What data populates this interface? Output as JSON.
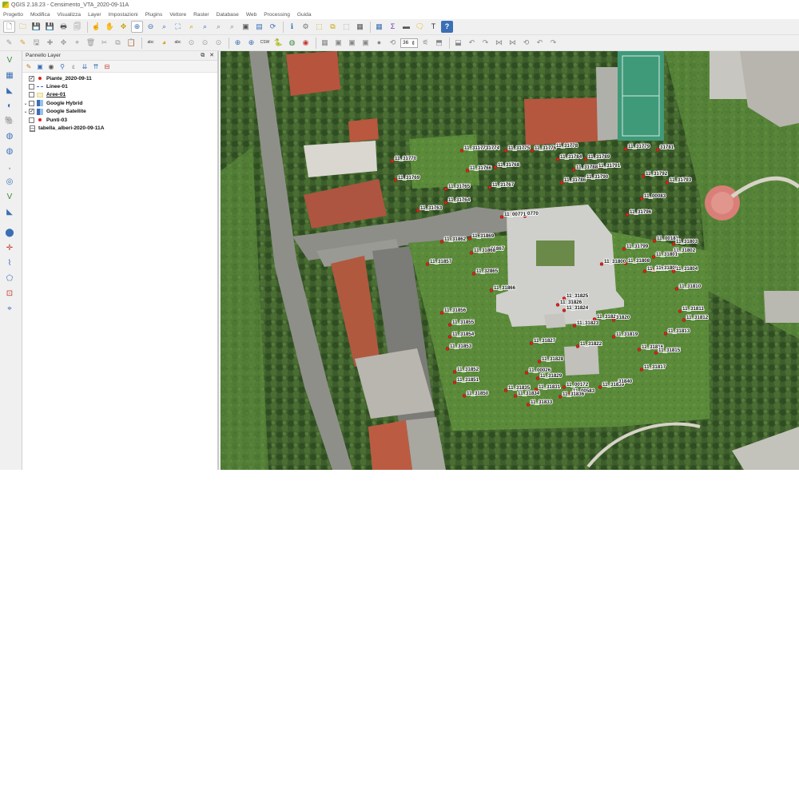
{
  "window": {
    "title": "QGIS 2.18.23 - Censimento_VTA_2020-09-11A"
  },
  "menubar": [
    "Progetto",
    "Modifica",
    "Visualizza",
    "Layer",
    "Impostazioni",
    "Plugins",
    "Vettore",
    "Raster",
    "Database",
    "Web",
    "Processing",
    "Guida"
  ],
  "toolbar1": {
    "icons": [
      "new-project-icon",
      "open-project-icon",
      "save-project-icon",
      "save-as-icon",
      "print-composer-icon",
      "composer-manager-icon",
      "touch-icon",
      "pan-icon",
      "pan-to-selection-icon",
      "zoom-in-icon",
      "zoom-out-icon",
      "zoom-native-icon",
      "zoom-full-icon",
      "zoom-selection-icon",
      "zoom-layer-icon",
      "zoom-last-icon",
      "zoom-next-icon",
      "new-map-view-icon",
      "bookmark-icon",
      "refresh-icon",
      "identify-icon",
      "run-action-icon",
      "select-feature-icon",
      "select-by-value-icon",
      "deselect-icon",
      "attribute-table-icon",
      "field-calculator-icon",
      "statistics-icon",
      "measure-icon",
      "annotation-icon",
      "text-annotation-icon",
      "help-icon"
    ]
  },
  "toolbar2": {
    "icons": [
      "current-edits-icon",
      "toggle-editing-icon",
      "save-edits-icon",
      "add-feature-icon",
      "move-feature-icon",
      "node-tool-icon",
      "delete-selected-icon",
      "cut-features-icon",
      "copy-features-icon",
      "paste-features-icon",
      "label-icon",
      "pin-labels-icon",
      "highlight-labels-icon",
      "move-label-icon",
      "rotate-label-icon",
      "change-label-icon",
      "search-location-icon",
      "geocode-icon",
      "csw-icon",
      "python-icon",
      "openlayers-icon",
      "plugin-icon",
      "digitize-add-ring-icon",
      "digitize-fill-ring-icon",
      "digitize-split-icon",
      "digitize-merge-icon",
      "digitize-circle-icon",
      "rotate-feature-icon",
      "simplify-icon",
      "add-part-icon",
      "delete-ring-icon",
      "offset-curve-icon",
      "reshape-icon",
      "split-parts-icon",
      "merge-attributes-icon",
      "rotate-point-icon",
      "undo-icon",
      "redo-icon"
    ],
    "zoom_value": "36"
  },
  "left_toolbar": {
    "icons": [
      "add-vector-icon",
      "add-raster-icon",
      "add-spatialite-icon",
      "add-wms-icon",
      "add-postgis-icon",
      "add-wcs-icon",
      "add-wfs-icon",
      "add-delimited-text-icon",
      "add-virtual-layer-icon",
      "new-shapefile-icon",
      "new-spatialite-icon",
      "new-gpx-icon",
      "add-point-icon",
      "capture-line-icon",
      "capture-polygon-icon",
      "vertex-icon",
      "georeference-icon"
    ]
  },
  "layer_panel": {
    "title": "Pannello Layer",
    "layers": [
      {
        "name": "Piante_2020-09-11",
        "checked": true,
        "expander": "",
        "symbol": "point-red",
        "style": "bold"
      },
      {
        "name": "Linee-01",
        "checked": false,
        "expander": "",
        "symbol": "line-dash",
        "style": "bold"
      },
      {
        "name": "Aree-01",
        "checked": false,
        "expander": "",
        "symbol": "poly-yellow",
        "style": "under"
      },
      {
        "name": "Google Hybrid",
        "checked": false,
        "expander": "⌄",
        "symbol": "raster",
        "style": "bold"
      },
      {
        "name": "Google Satellite",
        "checked": true,
        "expander": "⌄",
        "symbol": "raster",
        "style": "bold"
      },
      {
        "name": "Punti-03",
        "checked": false,
        "expander": "",
        "symbol": "point-red",
        "style": "bold"
      },
      {
        "name": "tabella_alberi-2020-09-11A",
        "checked": null,
        "expander": "",
        "symbol": "table",
        "style": "bold"
      }
    ]
  },
  "map": {
    "labels": [
      {
        "text": "11_31770",
        "x": 1,
        "y": 1
      },
      {
        "text": "11_31769",
        "x": 1,
        "y": 1
      },
      {
        "text": "11_31765",
        "x": 1,
        "y": 1
      },
      {
        "text": "11_31764",
        "x": 1,
        "y": 1
      },
      {
        "text": "11_31763",
        "x": 1,
        "y": 1
      },
      {
        "text": "11_3117731774",
        "x": 1,
        "y": 1
      },
      {
        "text": "11_31775",
        "x": 1,
        "y": 1
      },
      {
        "text": "11_31776",
        "x": 1,
        "y": 1
      },
      {
        "text": "11_31766",
        "x": 1,
        "y": 1
      },
      {
        "text": "11_31768",
        "x": 1,
        "y": 1
      },
      {
        "text": "11_31767",
        "x": 1,
        "y": 1
      },
      {
        "text": "11_31778",
        "x": 1,
        "y": 1
      },
      {
        "text": "11_31784",
        "x": 1,
        "y": 1
      },
      {
        "text": "11_31789",
        "x": 1,
        "y": 1
      },
      {
        "text": "11_31788",
        "x": 1,
        "y": 1
      },
      {
        "text": "11_31791",
        "x": 1,
        "y": 1
      },
      {
        "text": "11_31790",
        "x": 1,
        "y": 1
      },
      {
        "text": "11_31786",
        "x": 1,
        "y": 1
      },
      {
        "text": "11_00771",
        "x": 1,
        "y": 1
      },
      {
        "text": "0770",
        "x": 1,
        "y": 1
      },
      {
        "text": "11_31779",
        "x": 1,
        "y": 1
      },
      {
        "text": "31781",
        "x": 1,
        "y": 1
      },
      {
        "text": "11_31792",
        "x": 1,
        "y": 1
      },
      {
        "text": "11_31793",
        "x": 1,
        "y": 1
      },
      {
        "text": "11_00083",
        "x": 1,
        "y": 1
      },
      {
        "text": "11_31796",
        "x": 1,
        "y": 1
      },
      {
        "text": "11_31862",
        "x": 1,
        "y": 1
      },
      {
        "text": "11_31869",
        "x": 1,
        "y": 1
      },
      {
        "text": "31867",
        "x": 1,
        "y": 1
      },
      {
        "text": "11_31868",
        "x": 1,
        "y": 1
      },
      {
        "text": "11_31857",
        "x": 1,
        "y": 1
      },
      {
        "text": "11_32865",
        "x": 1,
        "y": 1
      },
      {
        "text": "11_31866",
        "x": 1,
        "y": 1
      },
      {
        "text": "11_00181",
        "x": 1,
        "y": 1
      },
      {
        "text": "11_31803",
        "x": 1,
        "y": 1
      },
      {
        "text": "11_31799",
        "x": 1,
        "y": 1
      },
      {
        "text": "11_31802",
        "x": 1,
        "y": 1
      },
      {
        "text": "11_31801",
        "x": 1,
        "y": 1
      },
      {
        "text": "11_31800",
        "x": 1,
        "y": 1
      },
      {
        "text": "11_31808",
        "x": 1,
        "y": 1
      },
      {
        "text": "11_31807",
        "x": 1,
        "y": 1
      },
      {
        "text": "11_31806",
        "x": 1,
        "y": 1
      },
      {
        "text": "11_31804",
        "x": 1,
        "y": 1
      },
      {
        "text": "11_31810",
        "x": 1,
        "y": 1
      },
      {
        "text": "11_31825",
        "x": 1,
        "y": 1
      },
      {
        "text": "11_31826",
        "x": 1,
        "y": 1
      },
      {
        "text": "11_31824",
        "x": 1,
        "y": 1
      },
      {
        "text": "11_31856",
        "x": 1,
        "y": 1
      },
      {
        "text": "11_31855",
        "x": 1,
        "y": 1
      },
      {
        "text": "11_31854",
        "x": 1,
        "y": 1
      },
      {
        "text": "11_31853",
        "x": 1,
        "y": 1
      },
      {
        "text": "11_31823",
        "x": 1,
        "y": 1
      },
      {
        "text": "11_31821",
        "x": 1,
        "y": 1
      },
      {
        "text": "31820",
        "x": 1,
        "y": 1
      },
      {
        "text": "11_31811",
        "x": 1,
        "y": 1
      },
      {
        "text": "11_31812",
        "x": 1,
        "y": 1
      },
      {
        "text": "11_31813",
        "x": 1,
        "y": 1
      },
      {
        "text": "11_31819",
        "x": 1,
        "y": 1
      },
      {
        "text": "11_31827",
        "x": 1,
        "y": 1
      },
      {
        "text": "11_31822",
        "x": 1,
        "y": 1
      },
      {
        "text": "11_31816",
        "x": 1,
        "y": 1
      },
      {
        "text": "11_31815",
        "x": 1,
        "y": 1
      },
      {
        "text": "11_31828",
        "x": 1,
        "y": 1
      },
      {
        "text": "11_31817",
        "x": 1,
        "y": 1
      },
      {
        "text": "11_31852",
        "x": 1,
        "y": 1
      },
      {
        "text": "11_00026",
        "x": 1,
        "y": 1
      },
      {
        "text": "11_31829",
        "x": 1,
        "y": 1
      },
      {
        "text": "11_31851",
        "x": 1,
        "y": 1
      },
      {
        "text": "11_31835",
        "x": 1,
        "y": 1
      },
      {
        "text": "11_31831",
        "x": 1,
        "y": 1
      },
      {
        "text": "11_00172",
        "x": 1,
        "y": 1
      },
      {
        "text": "11_31839",
        "x": 1,
        "y": 1
      },
      {
        "text": "31840",
        "x": 1,
        "y": 1
      },
      {
        "text": "11_00583",
        "x": 1,
        "y": 1
      },
      {
        "text": "11_31850",
        "x": 1,
        "y": 1
      },
      {
        "text": "11_31834",
        "x": 1,
        "y": 1
      },
      {
        "text": "11_31836",
        "x": 1,
        "y": 1
      },
      {
        "text": "11_31833",
        "x": 1,
        "y": 1
      }
    ]
  },
  "colors": {
    "tree_point": "#e0201c",
    "grass": "#4f7a33",
    "roof_red": "#b8553f",
    "roof_grey": "#c9c9c4",
    "road": "#8c8c88",
    "sports_field": "#3f9a7a"
  }
}
